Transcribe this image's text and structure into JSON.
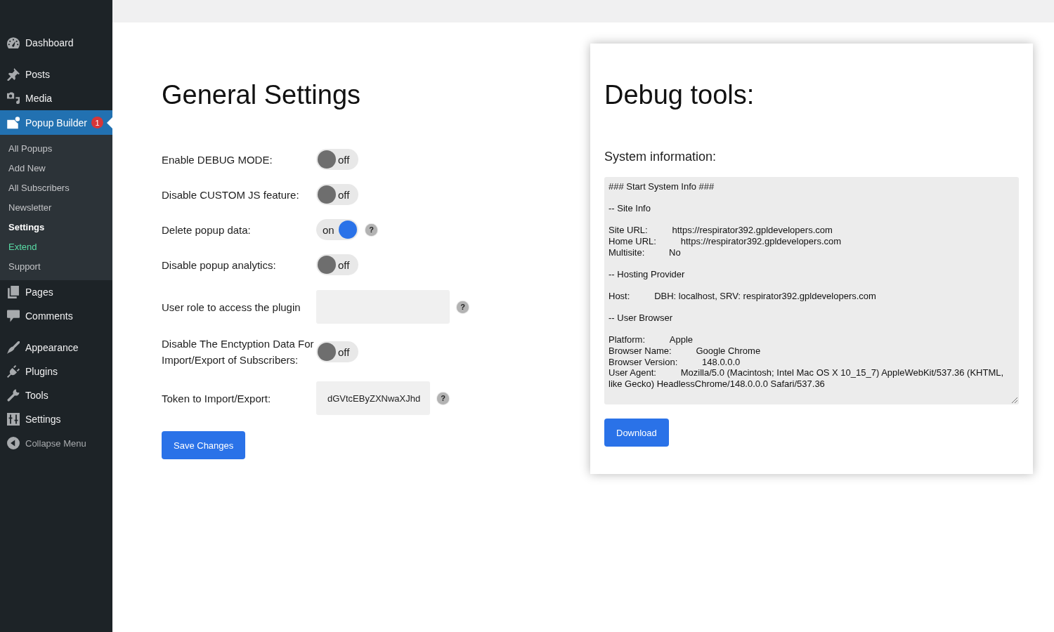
{
  "sidebar": {
    "groups": [
      {
        "items": [
          {
            "label": "Dashboard",
            "selected": false
          }
        ]
      },
      {
        "items": [
          {
            "label": "Posts",
            "selected": false
          },
          {
            "label": "Media",
            "selected": false
          },
          {
            "label": "Popup Builder",
            "selected": true,
            "badge": "1",
            "submenu": [
              {
                "label": "All Popups",
                "selected": false
              },
              {
                "label": "Add New",
                "selected": false
              },
              {
                "label": "All Subscribers",
                "selected": false
              },
              {
                "label": "Newsletter",
                "selected": false
              },
              {
                "label": "Settings",
                "selected": true
              },
              {
                "label": "Extend",
                "selected": false,
                "color": "#59dba5"
              },
              {
                "label": "Support",
                "selected": false
              }
            ]
          },
          {
            "label": "Pages",
            "selected": false
          },
          {
            "label": "Comments",
            "selected": false
          }
        ]
      },
      {
        "items": [
          {
            "label": "Appearance",
            "selected": false
          },
          {
            "label": "Plugins",
            "selected": false
          },
          {
            "label": "Tools",
            "selected": false
          },
          {
            "label": "Settings",
            "selected": false
          }
        ]
      }
    ],
    "collapse_label": "Collapse Menu"
  },
  "general_settings": {
    "title": "General Settings",
    "rows": [
      {
        "kind": "toggle",
        "label": "Enable DEBUG MODE:",
        "on": false,
        "state_label": "off"
      },
      {
        "kind": "toggle",
        "label": "Disable CUSTOM JS feature:",
        "on": false,
        "state_label": "off"
      },
      {
        "kind": "toggle",
        "label": "Delete popup data:",
        "on": true,
        "state_label": "on",
        "help": "?"
      },
      {
        "kind": "toggle",
        "label": "Disable popup analytics:",
        "on": false,
        "state_label": "off"
      },
      {
        "kind": "select",
        "label": "User role to access the plugin",
        "help": "?"
      },
      {
        "kind": "toggle",
        "label": "Disable The Enctyption Data For Import/Export of Subscribers:",
        "on": false,
        "state_label": "off"
      },
      {
        "kind": "text",
        "label": "Token to Import/Export:",
        "value": "dGVtcEByZXNwaXJhd",
        "help": "?"
      }
    ],
    "save_button": "Save Changes"
  },
  "debug_tools": {
    "title": "Debug tools:",
    "subtitle": "System information:",
    "system_info": {
      "heading": "### Start System Info ###",
      "sections": [
        {
          "title": "-- Site Info",
          "entries": [
            {
              "label": "Site URL:",
              "value": "https://respirator392.gpldevelopers.com"
            },
            {
              "label": "Home URL:",
              "value": "https://respirator392.gpldevelopers.com"
            },
            {
              "label": "Multisite:",
              "value": "No"
            }
          ]
        },
        {
          "title": "-- Hosting Provider",
          "entries": [
            {
              "label": "Host:",
              "value": "DBH: localhost, SRV: respirator392.gpldevelopers.com"
            }
          ]
        },
        {
          "title": "-- User Browser",
          "entries": [
            {
              "label": "Platform:",
              "value": "Apple"
            },
            {
              "label": "Browser Name:",
              "value": "Google Chrome"
            },
            {
              "label": "Browser Version:",
              "value": "148.0.0.0"
            },
            {
              "label": "User Agent:",
              "value": "Mozilla/5.0 (Macintosh; Intel Mac OS X 10_15_7) AppleWebKit/537.36 (KHTML, like Gecko) HeadlessChrome/148.0.0.0 Safari/537.36"
            }
          ]
        }
      ]
    },
    "download_button": "Download"
  }
}
